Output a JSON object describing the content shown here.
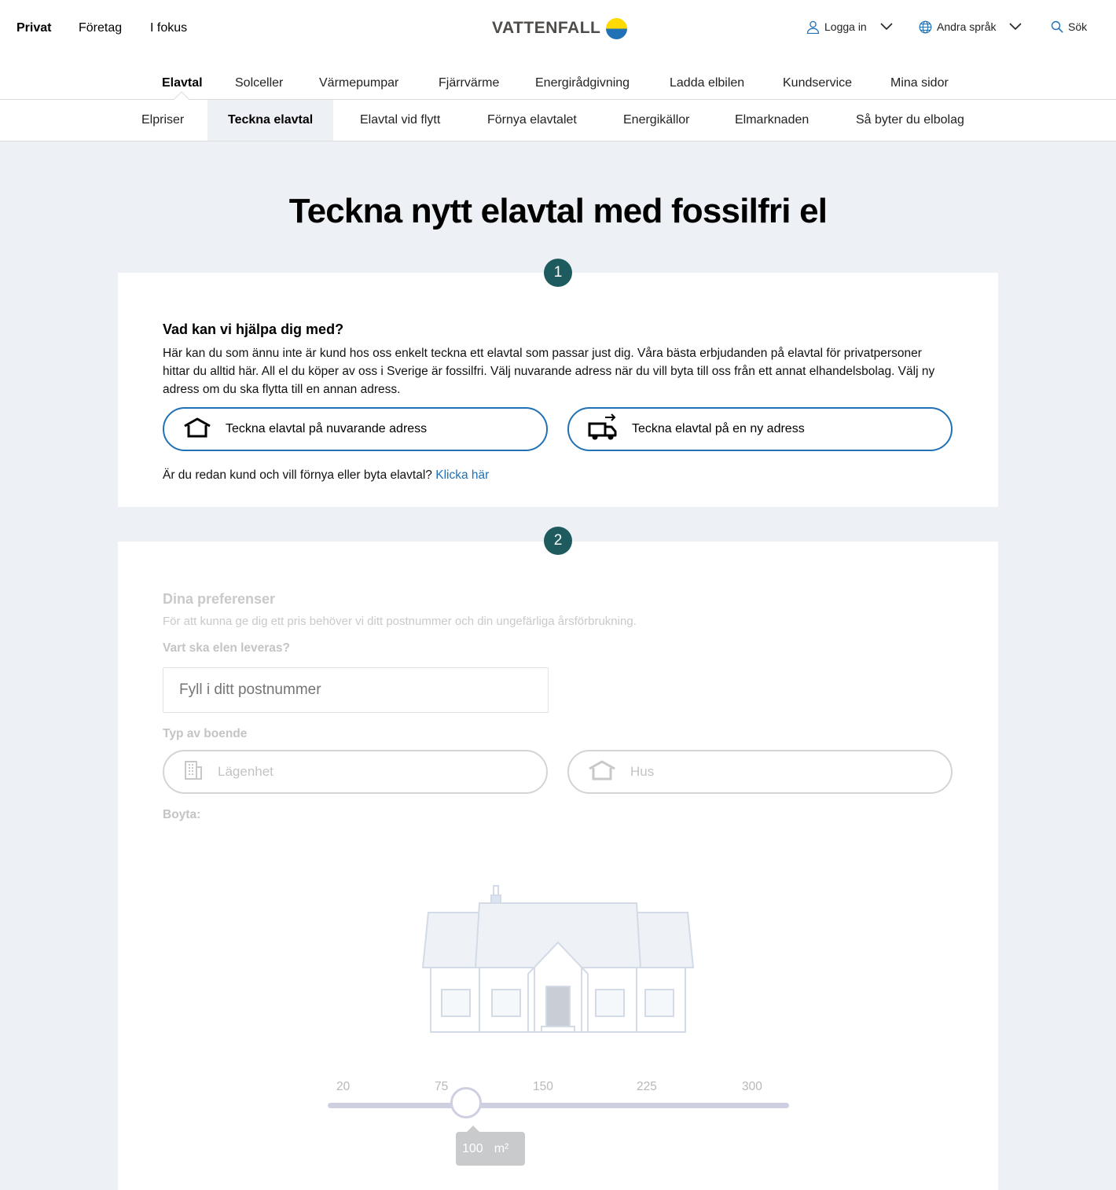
{
  "header": {
    "segments": [
      "Privat",
      "Företag",
      "I fokus"
    ],
    "logo_text": "VATTENFALL",
    "login_label": "Logga in",
    "language_label": "Andra språk",
    "search_label": "Sök"
  },
  "main_nav": [
    "Elavtal",
    "Solceller",
    "Värmepumpar",
    "Fjärrvärme",
    "Energirådgivning",
    "Ladda elbilen",
    "Kundservice",
    "Mina sidor"
  ],
  "sub_nav": [
    "Elpriser",
    "Teckna elavtal",
    "Elavtal vid flytt",
    "Förnya elavtalet",
    "Energikällor",
    "Elmarknaden",
    "Så byter du elbolag"
  ],
  "page_title": "Teckna nytt elavtal med fossilfri el",
  "step1": {
    "number": "1",
    "title": "Vad kan vi hjälpa dig med?",
    "text": "Här kan du som ännu inte är kund hos oss enkelt teckna ett elavtal som passar just dig. Våra bästa erbjudanden på elavtal för privatpersoner hittar du alltid här. All el du köper av oss i Sverige är fossilfri. Välj nuvarande adress när du vill byta till oss från ett annat elhandelsbolag. Välj ny adress om du ska flytta till en annan adress.",
    "option_current": "Teckna elavtal på nuvarande adress",
    "option_new": "Teckna elavtal på en ny adress",
    "existing_question": "Är du redan kund och vill förnya eller byta elavtal?",
    "existing_link": "Klicka här"
  },
  "step2": {
    "number": "2",
    "title": "Dina preferenser",
    "text": "För att kunna ge dig ett pris behöver vi ditt postnummer och din ungefärliga årsförbrukning.",
    "delivery_label": "Vart ska elen leveras?",
    "postal_placeholder": "Fyll i ditt postnummer",
    "housing_label": "Typ av boende",
    "option_apartment": "Lägenhet",
    "option_house": "Hus",
    "area_label": "Boyta:",
    "slider": {
      "ticks": [
        "20",
        "75",
        "150",
        "225",
        "300"
      ],
      "min": 20,
      "max": 300,
      "value": "100",
      "unit": "m²"
    }
  },
  "colors": {
    "brand_blue": "#2071b5",
    "brand_yellow": "#ffda00",
    "step_badge": "#1e5b5e",
    "page_bg": "#edf1f6"
  }
}
